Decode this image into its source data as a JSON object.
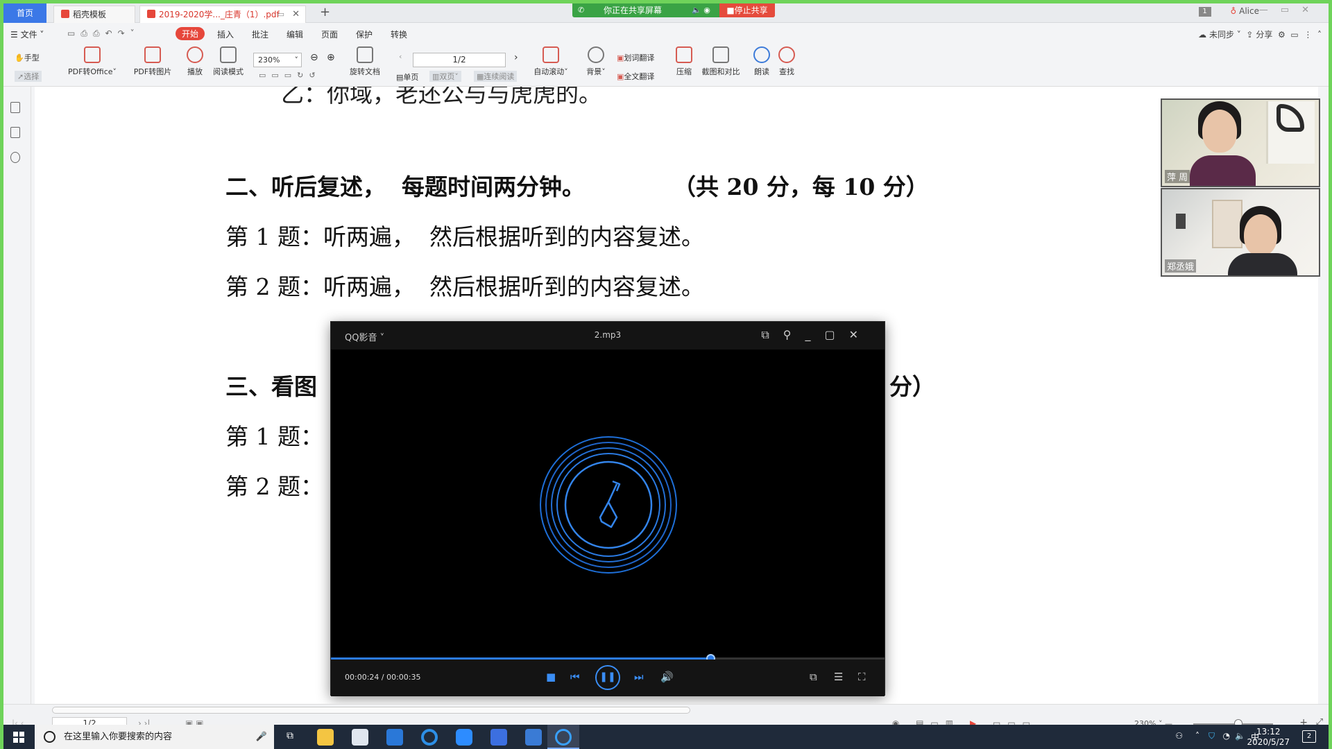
{
  "tabs": {
    "home": "首页",
    "docer": "稻壳模板",
    "pdf": "2019-2020学..._庄青（1）.pdf",
    "new_tab": "+"
  },
  "share": {
    "status": "你正在共享屏幕",
    "stop": "停止共享"
  },
  "user": {
    "badge": "1",
    "name": "Alice"
  },
  "menu": {
    "file": "文件",
    "start": "开始",
    "insert": "插入",
    "annotate": "批注",
    "edit": "编辑",
    "page": "页面",
    "protect": "保护",
    "convert": "转换",
    "sync": "未同步",
    "share": "分享"
  },
  "ribbon": {
    "hand": "手型",
    "select": "选择",
    "pdf_to_office": "PDF转Office",
    "pdf_to_image": "PDF转图片",
    "play": "播放",
    "read_mode": "阅读模式",
    "zoom": "230%",
    "rotate": "旋转文档",
    "single": "单页",
    "double": "双页",
    "continuous": "连续阅读",
    "page": "1/2",
    "auto_scroll": "自动滚动",
    "background": "背景",
    "word_translate": "划词翻译",
    "full_translate": "全文翻译",
    "compress": "压缩",
    "screenshot_compare": "截图和对比",
    "read_aloud": "朗读",
    "find": "查找"
  },
  "document": {
    "top_partial": "乙：你域，老还公与与虎虎的。",
    "section2_title": "二、听后复述，  每题时间两分钟。",
    "section2_score": "（共 20 分，每 10 分）",
    "s2_q1": "第 1 题：听两遍，  然后根据听到的内容复述。",
    "s2_q2": "第 2 题：听两遍，  然后根据听到的内容复述。",
    "section3_title": "三、看图",
    "section3_score_tail": "分）",
    "s3_q1": "第 1 题：",
    "s3_q2": "第 2 题："
  },
  "participants": [
    {
      "name": "萍 周"
    },
    {
      "name": "郑丞娥"
    }
  ],
  "player": {
    "app_name": "QQ影音",
    "file": "2.mp3",
    "elapsed": "00:00:24",
    "total": "00:00:35",
    "time_text": "00:00:24 / 00:00:35",
    "progress": 0.686,
    "accent": "#2b7be8"
  },
  "status": {
    "page": "1/2",
    "zoom": "230%"
  },
  "taskbar": {
    "search_placeholder": "在这里输入你要搜索的内容",
    "time": "13:12",
    "date": "2020/5/27",
    "ime": "中",
    "notifications": "2"
  },
  "colors": {
    "share_green": "#3aa345",
    "stop_red": "#e54b3c",
    "window_border": "#6fd35a",
    "accent_blue": "#3b78e7",
    "wps_red": "#e6473b"
  }
}
